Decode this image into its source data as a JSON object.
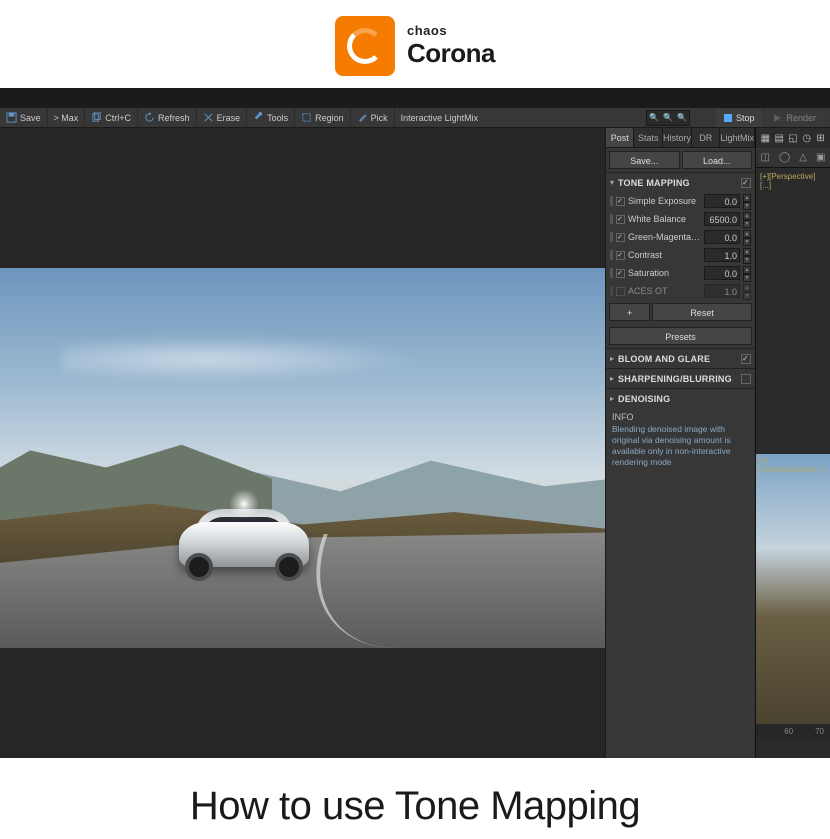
{
  "logo": {
    "top": "chaos",
    "main": "Corona"
  },
  "toolbar": {
    "save": "Save",
    "max": "> Max",
    "ctrlc": "Ctrl+C",
    "refresh": "Refresh",
    "erase": "Erase",
    "tools": "Tools",
    "region": "Region",
    "pick": "Pick",
    "interactive_lightmix": "Interactive LightMix",
    "stop": "Stop",
    "render": "Render"
  },
  "tabs": {
    "post": "Post",
    "stats": "Stats",
    "history": "History",
    "dr": "DR",
    "lightmix": "LightMix"
  },
  "panel": {
    "save_btn": "Save...",
    "load_btn": "Load...",
    "tone_mapping": "TONE MAPPING",
    "props": {
      "simple_exposure": {
        "label": "Simple Exposure",
        "value": "0.0"
      },
      "white_balance": {
        "label": "White Balance",
        "value": "6500.0"
      },
      "green_magenta": {
        "label": "Green-Magenta Ti...",
        "value": "0.0"
      },
      "contrast": {
        "label": "Contrast",
        "value": "1.0"
      },
      "saturation": {
        "label": "Saturation",
        "value": "0.0"
      },
      "aces_ot": {
        "label": "ACES OT",
        "value": "1.0"
      }
    },
    "plus": "+",
    "reset": "Reset",
    "presets": "Presets",
    "bloom": "BLOOM AND GLARE",
    "sharpening": "SHARPENING/BLURRING",
    "denoising": "DENOISING",
    "info_title": "INFO",
    "info_text": "Blending denoised image with original via denoising amount is available only in non-interactive rendering mode"
  },
  "viewport": {
    "perspective": "[+][Perspective][...]",
    "corona_camera": "[+][CoronaCamera...]",
    "ruler": {
      "a": "60",
      "b": "70"
    }
  },
  "footer": "How to use Tone Mapping"
}
